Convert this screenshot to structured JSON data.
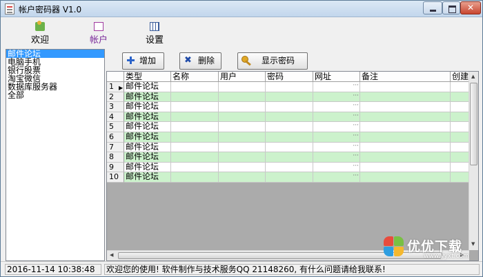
{
  "window": {
    "title": "帐户密码器 V1.0"
  },
  "nav": [
    {
      "label": "欢迎",
      "icon": "welcome-icon"
    },
    {
      "label": "帐户",
      "icon": "accounts-icon",
      "active": true
    },
    {
      "label": "设置",
      "icon": "settings-icon"
    }
  ],
  "categories": [
    "邮件论坛",
    "电脑手机",
    "银行股票",
    "淘宝微信",
    "数据库服务器",
    "全部"
  ],
  "selected_category": "邮件论坛",
  "toolbar": {
    "add": "增加",
    "delete": "删除",
    "show_password": "显示密码"
  },
  "grid": {
    "columns": [
      "类型",
      "名称",
      "用户",
      "密码",
      "网址",
      "备注",
      "创建"
    ],
    "rows": [
      {
        "num": "1",
        "type": "邮件论坛"
      },
      {
        "num": "2",
        "type": "邮件论坛"
      },
      {
        "num": "3",
        "type": "邮件论坛"
      },
      {
        "num": "4",
        "type": "邮件论坛"
      },
      {
        "num": "5",
        "type": "邮件论坛"
      },
      {
        "num": "6",
        "type": "邮件论坛"
      },
      {
        "num": "7",
        "type": "邮件论坛"
      },
      {
        "num": "8",
        "type": "邮件论坛"
      },
      {
        "num": "9",
        "type": "邮件论坛"
      },
      {
        "num": "10",
        "type": "邮件论坛"
      }
    ],
    "url_ellipsis": "···",
    "current_row_marker": "▶"
  },
  "status": {
    "datetime": "2016-11-14 10:38:48",
    "message": "欢迎您的使用! 软件制作与技术服务QQ 21148260, 有什么问题请给我联系!"
  },
  "watermark": {
    "text": "优优下载",
    "url": "www.yyxt.com"
  },
  "colors": {
    "alt_row": "#ccf2cc",
    "selection": "#3399ff",
    "accent_tab": "#7a2a9a"
  }
}
